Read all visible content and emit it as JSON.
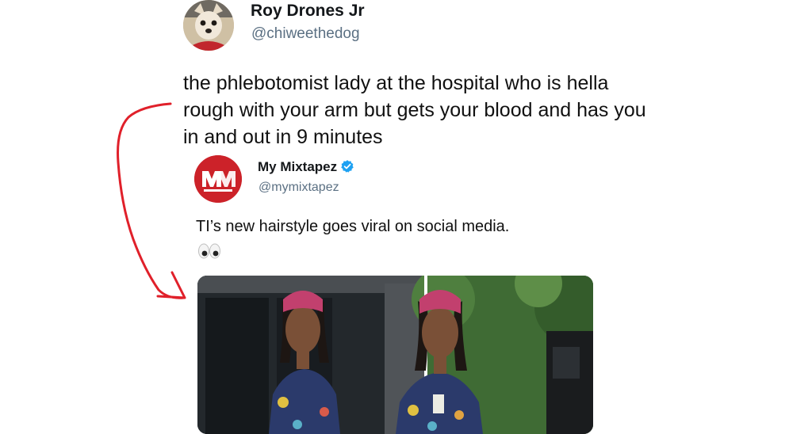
{
  "tweet": {
    "author_name": "Roy Drones Jr",
    "author_handle": "@chiweethedog",
    "text": "the phlebotomist lady at the hospital who is hella rough with your arm but gets your blood and has you in and out in 9 minutes",
    "avatar_icon": "dog-avatar-icon"
  },
  "quoted_tweet": {
    "author_name": "My Mixtapez",
    "author_handle": "@mymixtapez",
    "verified": true,
    "text": "TI’s new hairstyle goes viral on social media.",
    "emoji": "eyes-emoji",
    "avatar_icon": "mymixtapez-logo-icon",
    "media_description_icon": "photo-collage-icon"
  },
  "colors": {
    "handle": "#5b7083",
    "verified": "#1da1f2",
    "logo_red": "#cc2229",
    "arrow_red": "#e0202a"
  }
}
